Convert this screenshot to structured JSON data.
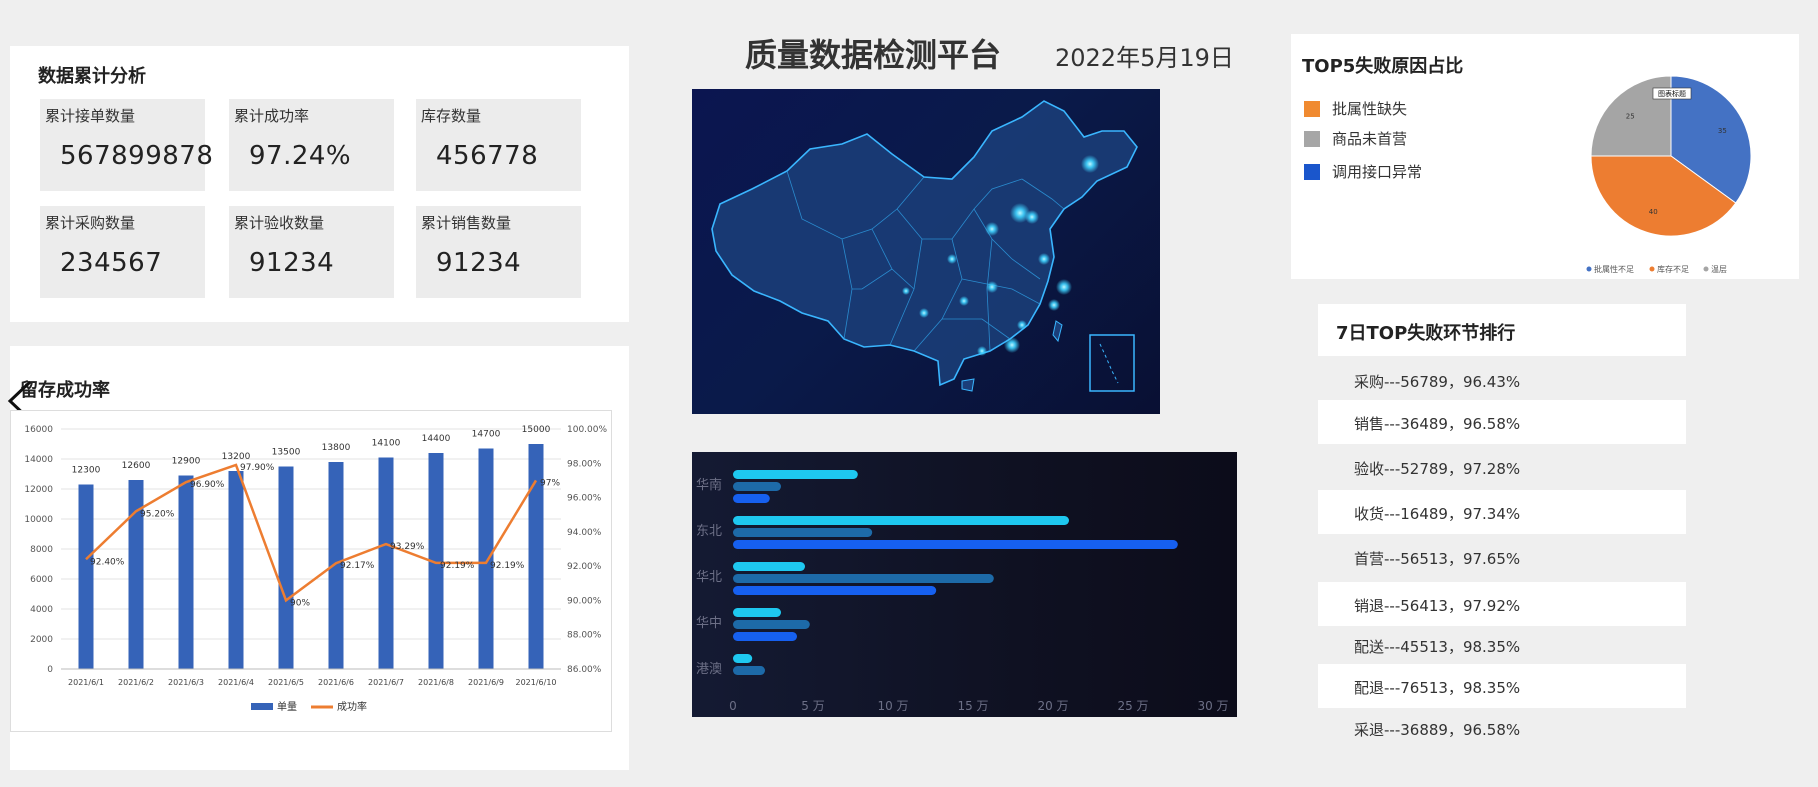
{
  "header": {
    "title": "质量数据检测平台",
    "date": "2022年5月19日"
  },
  "cumulative": {
    "title": "数据累计分析",
    "stats": [
      {
        "label": "累计接单数量",
        "value": "567899878"
      },
      {
        "label": "累计成功率",
        "value": "97.24%"
      },
      {
        "label": "库存数量",
        "value": "456778"
      },
      {
        "label": "累计采购数量",
        "value": "234567"
      },
      {
        "label": "累计验收数量",
        "value": "91234"
      },
      {
        "label": "累计销售数量",
        "value": "91234"
      }
    ]
  },
  "retention": {
    "title": "留存成功率"
  },
  "top5": {
    "title": "TOP5失败原因占比",
    "legend": [
      {
        "label": "批属性缺失",
        "color": "#f08a30"
      },
      {
        "label": "商品未首营",
        "color": "#a6a6a6"
      },
      {
        "label": "调用接口异常",
        "color": "#1a56cc"
      }
    ]
  },
  "ranking": {
    "title": "7日TOP失败环节排行",
    "items": [
      "采购---56789，96.43%",
      "销售---36489，96.58%",
      "验收---52789，97.28%",
      "收货---16489，97.34%",
      "首营---56513，97.65%",
      "销退---56413，97.92%",
      "配送---45513，98.35%",
      "配退---76513，98.35%",
      "采退---36889，96.58%"
    ]
  },
  "chart_data": [
    {
      "type": "bar",
      "title": "",
      "categories": [
        "2021/6/1",
        "2021/6/2",
        "2021/6/3",
        "2021/6/4",
        "2021/6/5",
        "2021/6/6",
        "2021/6/7",
        "2021/6/8",
        "2021/6/9",
        "2021/6/10"
      ],
      "series": [
        {
          "name": "单量",
          "type": "bar",
          "color": "#3563b8",
          "values": [
            12300,
            12600,
            12900,
            13200,
            13500,
            13800,
            14100,
            14400,
            14700,
            15000
          ]
        },
        {
          "name": "成功率",
          "type": "line",
          "color": "#ed7d31",
          "values": [
            92.4,
            95.2,
            96.9,
            97.9,
            90.0,
            92.17,
            93.29,
            92.19,
            92.19,
            97.0
          ],
          "labels": [
            "92.40%",
            "95.20%",
            "96.90%",
            "97.90%",
            "90%",
            "92.17%",
            "93.29%",
            "92.19%",
            "92.19%",
            "97%"
          ]
        }
      ],
      "ylim": [
        0,
        16000
      ],
      "y_ticks": [
        0,
        2000,
        4000,
        6000,
        8000,
        10000,
        12000,
        14000,
        16000
      ],
      "y2lim": [
        86,
        100
      ],
      "y2_ticks": [
        "86.00%",
        "88.00%",
        "90.00%",
        "92.00%",
        "94.00%",
        "96.00%",
        "98.00%",
        "100.00%"
      ],
      "legend_position": "bottom"
    },
    {
      "type": "pie",
      "title": "",
      "tag_label": "图表标题",
      "slices": [
        {
          "label": "批属性不足",
          "value": 35,
          "color": "#4472c4"
        },
        {
          "label": "库存不足",
          "value": 40,
          "color": "#ed7d31"
        },
        {
          "label": "温层",
          "value": 25,
          "color": "#a5a5a5"
        }
      ],
      "legend_position": "bottom"
    },
    {
      "type": "bar",
      "orientation": "horizontal",
      "categories": [
        "华南",
        "东北",
        "华北",
        "华中",
        "港澳"
      ],
      "series": [
        {
          "color": "#1ec8f0",
          "values": [
            78000,
            210000,
            45000,
            30000,
            12000
          ]
        },
        {
          "color": "#1d6aa8",
          "values": [
            30000,
            87000,
            163000,
            48000,
            20000
          ]
        },
        {
          "color": "#1660f0",
          "values": [
            23000,
            278000,
            127000,
            40000,
            0
          ]
        }
      ],
      "xlim": [
        0,
        300000
      ],
      "x_ticks": [
        "0",
        "5 万",
        "10 万",
        "15 万",
        "20 万",
        "25 万",
        "30 万"
      ]
    }
  ]
}
